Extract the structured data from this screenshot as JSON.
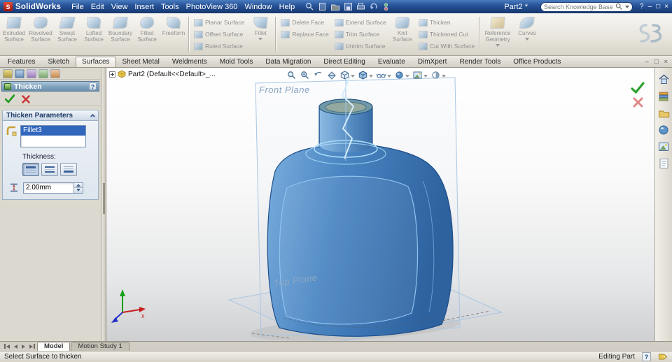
{
  "window": {
    "app_name": "SolidWorks",
    "document_title": "Part2 *",
    "search_placeholder": "Search Knowledge Base",
    "controls": {
      "help": "?",
      "minimize": "–",
      "maximize": "□",
      "close": "×"
    }
  },
  "menu": {
    "items": [
      "File",
      "Edit",
      "View",
      "Insert",
      "Tools",
      "PhotoView 360",
      "Window",
      "Help"
    ]
  },
  "ribbon": {
    "surface_buttons": [
      "Extruded Surface",
      "Revolved Surface",
      "Swept Surface",
      "Lofted Surface",
      "Boundary Surface",
      "Filled Surface",
      "Freeform"
    ],
    "planar_surface": "Planar Surface",
    "offset_surface": "Offset Surface",
    "ruled_surface": "Ruled Surface",
    "fillet": "Fillet",
    "delete_face": "Delete Face",
    "replace_face": "Replace Face",
    "extend_surface": "Extend Surface",
    "trim_surface": "Trim Surface",
    "untrim_surface": "Untrim Surface",
    "knit_surface": "Knit Surface",
    "thicken": "Thicken",
    "thickened_cut": "Thickened Cut",
    "cut_with_surface": "Cut With Surface",
    "reference_geometry": "Reference Geometry",
    "curves": "Curves"
  },
  "command_tabs": {
    "items": [
      "Features",
      "Sketch",
      "Surfaces",
      "Sheet Metal",
      "Weldments",
      "Mold Tools",
      "Data Migration",
      "Direct Editing",
      "Evaluate",
      "DimXpert",
      "Render Tools",
      "Office Products"
    ],
    "active": "Surfaces"
  },
  "property_manager": {
    "title": "Thicken",
    "help_glyph": "?",
    "section_title": "Thicken Parameters",
    "selected_item": "Fillet3",
    "thickness_label": "Thickness:",
    "thickness_value": "2.00mm"
  },
  "feature_tree": {
    "root_label": "Part2 (Default<<Default>_..."
  },
  "viewport_labels": {
    "front_plane": "Front Plane",
    "top_plane": "Top Plane",
    "axis_x": "x"
  },
  "doc_tabs": {
    "items": [
      "Model",
      "Motion Study 1"
    ],
    "active": "Model"
  },
  "status_bar": {
    "message": "Select Surface to thicken",
    "mode": "Editing Part",
    "help_glyph": "?"
  },
  "colors": {
    "titlebar_blue": "#28549a",
    "selection_blue": "#3166bd",
    "model_blue": "#4a85c2",
    "highlight_edge": "#a8dcf8",
    "plane_edge": "#a9c6e2"
  }
}
